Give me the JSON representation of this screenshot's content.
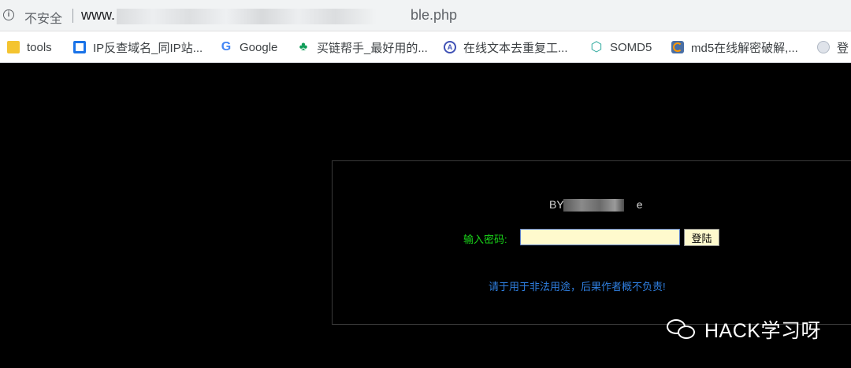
{
  "browser": {
    "security_label": "不安全",
    "url_prefix": "www.",
    "url_suffix": "ble.php"
  },
  "bookmarks": [
    {
      "label": "tools",
      "icon": "folder-icon"
    },
    {
      "label": "IP反查域名_同IP站...",
      "icon": "ip-lookup-icon"
    },
    {
      "label": "Google",
      "icon": "google-icon"
    },
    {
      "label": "买链帮手_最好用的...",
      "icon": "link-helper-icon"
    },
    {
      "label": "在线文本去重复工...",
      "icon": "dedupe-tool-icon"
    },
    {
      "label": "SOMD5",
      "icon": "somd5-icon"
    },
    {
      "label": "md5在线解密破解,...",
      "icon": "md5-icon"
    },
    {
      "label": "登",
      "icon": "globe-icon"
    }
  ],
  "page": {
    "by_label": "BY",
    "by_suffix": "e",
    "password_label": "输入密码:",
    "password_value": "",
    "login_button": "登陆",
    "disclaimer": "请于用于非法用途，后果作者概不负责!"
  },
  "watermark": {
    "text": "HACK学习呀"
  },
  "colors": {
    "background": "#000000",
    "label_green": "#19d419",
    "disclaimer_blue": "#2f7fe0",
    "input_fill": "#fffacd"
  }
}
